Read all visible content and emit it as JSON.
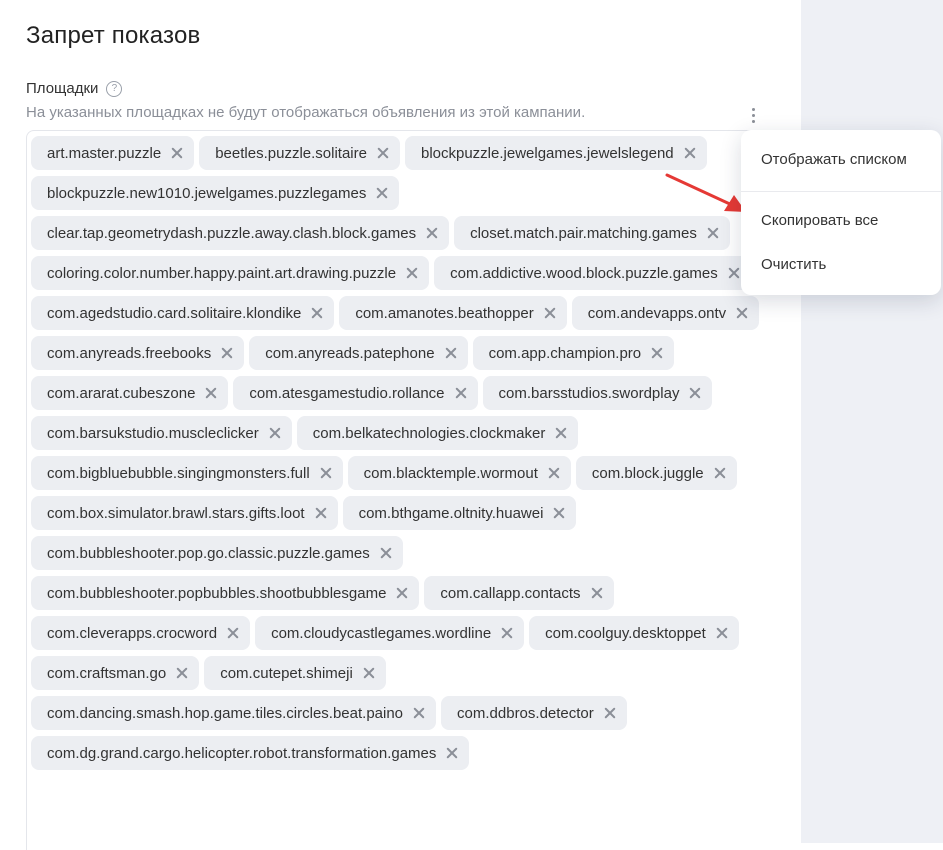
{
  "page": {
    "title": "Запрет показов",
    "field_label": "Площадки",
    "help_icon": "question-circle-icon",
    "hint": "На указанных площадках не будут отображаться объявления из этой кампании."
  },
  "tags": [
    "art.master.puzzle",
    "beetles.puzzle.solitaire",
    "blockpuzzle.jewelgames.jewelslegend",
    "blockpuzzle.new1010.jewelgames.puzzlegames",
    "clear.tap.geometrydash.puzzle.away.clash.block.games",
    "closet.match.pair.matching.games",
    "coloring.color.number.happy.paint.art.drawing.puzzle",
    "com.addictive.wood.block.puzzle.games",
    "com.agedstudio.card.solitaire.klondike",
    "com.amanotes.beathopper",
    "com.andevapps.ontv",
    "com.anyreads.freebooks",
    "com.anyreads.patephone",
    "com.app.champion.pro",
    "com.ararat.cubeszone",
    "com.atesgamestudio.rollance",
    "com.barsstudios.swordplay",
    "com.barsukstudio.muscleclicker",
    "com.belkatechnologies.clockmaker",
    "com.bigbluebubble.singingmonsters.full",
    "com.blacktemple.wormout",
    "com.block.juggle",
    "com.box.simulator.brawl.stars.gifts.loot",
    "com.bthgame.oltnity.huawei",
    "com.bubbleshooter.pop.go.classic.puzzle.games",
    "com.bubbleshooter.popbubbles.shootbubblesgame",
    "com.callapp.contacts",
    "com.cleverapps.crocword",
    "com.cloudycastlegames.wordline",
    "com.coolguy.desktoppet",
    "com.craftsman.go",
    "com.cutepet.shimeji",
    "com.dancing.smash.hop.game.tiles.circles.beat.paino",
    "com.ddbros.detector",
    "com.dg.grand.cargo.helicopter.robot.transformation.games"
  ],
  "menu": {
    "show_as_list": "Отображать списком",
    "copy_all": "Скопировать все",
    "clear": "Очистить"
  },
  "colors": {
    "tag_bg": "#eceef2",
    "arrow": "#e53935",
    "right_pane_bg": "#eef0f5"
  }
}
